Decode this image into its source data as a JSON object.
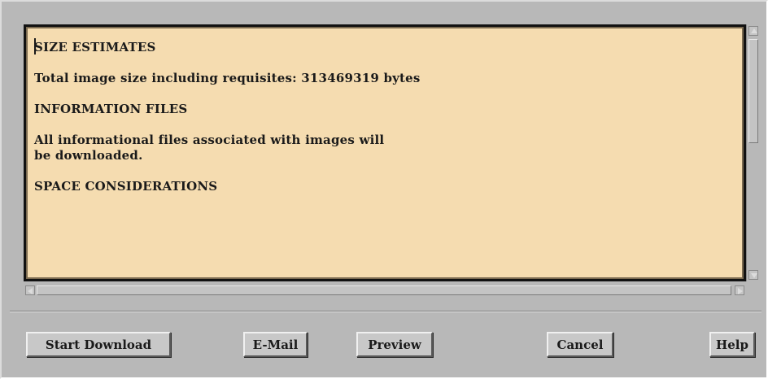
{
  "text_area": {
    "lines": [
      "SIZE ESTIMATES",
      "",
      "Total image size including requisites: 313469319 bytes",
      "",
      "INFORMATION FILES",
      "",
      "All informational files associated with images will",
      "be downloaded.",
      "",
      "SPACE CONSIDERATIONS"
    ],
    "background_color": "#f5dcb0"
  },
  "buttons": {
    "start_download": "Start Download",
    "email": "E-Mail",
    "preview": "Preview",
    "cancel": "Cancel",
    "help": "Help"
  },
  "icons": {
    "scroll_up": "triangle-up-icon",
    "scroll_down": "triangle-down-icon",
    "scroll_left": "triangle-left-icon",
    "scroll_right": "triangle-right-icon"
  }
}
